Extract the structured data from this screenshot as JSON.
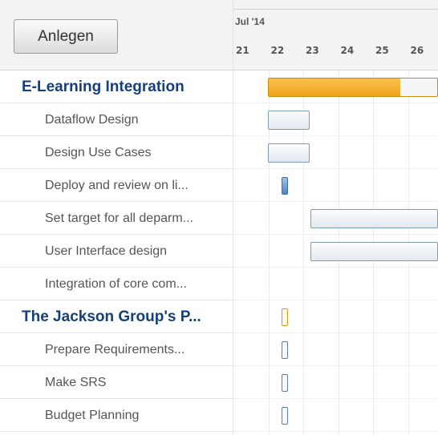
{
  "toolbar": {
    "add_label": "Anlegen"
  },
  "timeline": {
    "month": "Jul '14",
    "days": [
      "21",
      "22",
      "23",
      "24",
      "25",
      "26"
    ]
  },
  "rows": [
    {
      "kind": "group",
      "label": "E-Learning Integration",
      "progress": 0.78
    },
    {
      "kind": "task",
      "label": "Dataflow Design"
    },
    {
      "kind": "task",
      "label": "Design Use Cases"
    },
    {
      "kind": "task",
      "label": "Deploy and review on li..."
    },
    {
      "kind": "task",
      "label": "Set target for all deparm..."
    },
    {
      "kind": "task",
      "label": "User Interface design"
    },
    {
      "kind": "task",
      "label": "Integration of core com..."
    },
    {
      "kind": "group",
      "label": "The Jackson Group's P..."
    },
    {
      "kind": "task",
      "label": "Prepare Requirements..."
    },
    {
      "kind": "task",
      "label": "Make SRS"
    },
    {
      "kind": "task",
      "label": "Budget Planning"
    }
  ],
  "colors": {
    "group_text": "#16407a",
    "progress_fill": "#f0a31b",
    "bar_border": "#7f9cb5"
  }
}
